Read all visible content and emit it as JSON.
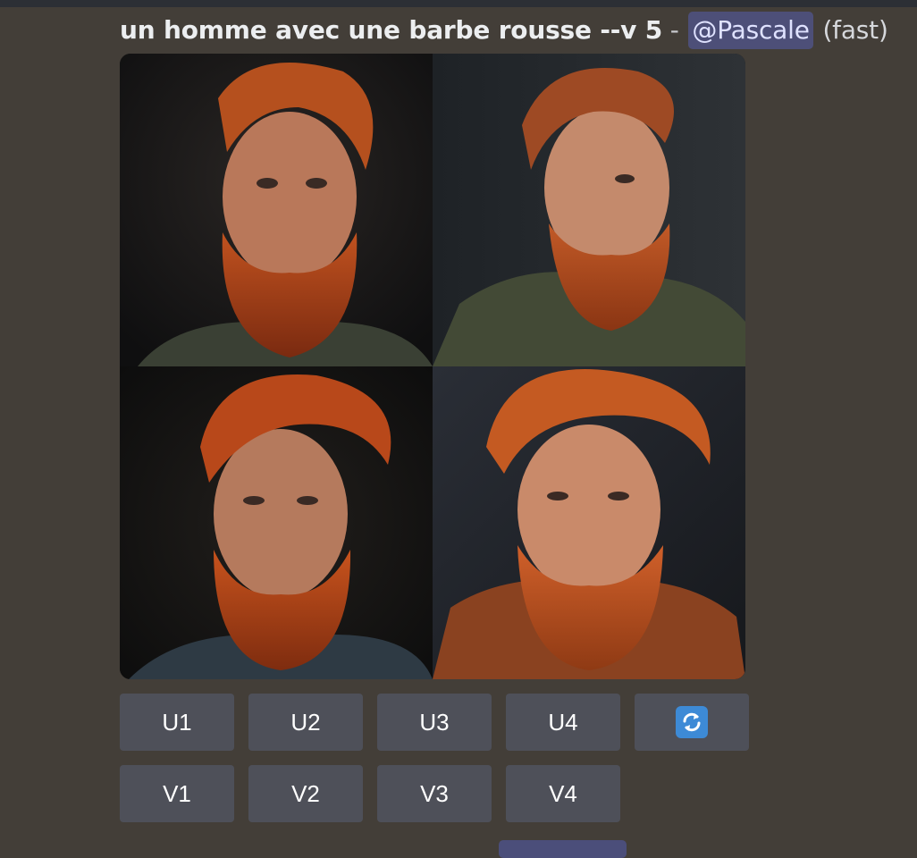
{
  "message": {
    "prompt": "un homme avec une barbe rousse --v 5",
    "separator": " - ",
    "mention": "@Pascale",
    "speed": "(fast)"
  },
  "image_grid": {
    "quadrants": [
      {
        "index": 1,
        "subject": "red-bearded man, dark green t-shirt"
      },
      {
        "index": 2,
        "subject": "red-bearded man, olive jacket"
      },
      {
        "index": 3,
        "subject": "red-bearded man, denim jacket"
      },
      {
        "index": 4,
        "subject": "red-bearded man, orange hoodie"
      }
    ]
  },
  "buttons": {
    "upscale": [
      "U1",
      "U2",
      "U3",
      "U4"
    ],
    "variation": [
      "V1",
      "V2",
      "V3",
      "V4"
    ],
    "reroll_icon": "refresh-icon"
  },
  "colors": {
    "background": "#433e38",
    "button": "#4e5059",
    "mention_bg": "#4d4f78",
    "reroll_blue": "#3d8ad6"
  }
}
